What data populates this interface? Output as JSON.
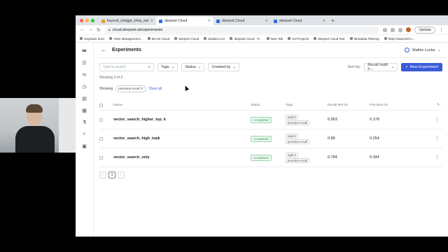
{
  "browser": {
    "tabs": [
      {
        "label": "beyond_chatgpt_infoq_webin...",
        "active": false
      },
      {
        "label": "deepset Cloud",
        "active": true
      },
      {
        "label": "deepset Cloud",
        "active": false
      },
      {
        "label": "deepset Cloud",
        "active": false
      }
    ],
    "url": "cloud.deepset.ai/experiments",
    "update_label": "Update",
    "bookmarks": [
      "Haystack docs",
      "AWS Management...",
      "MAAZ Cloud",
      "deepset Cloud",
      "dualtext ec2",
      "deepset Cloud - P...",
      "New Tab",
      "Sol Projects",
      "deepset Cloud Test",
      "Metadata Filtering",
      "https://www.letf.o..."
    ]
  },
  "header": {
    "title": "Experiments",
    "user_name": "Mathis Lucka"
  },
  "filters": {
    "search_placeholder": "Type to search",
    "tags_label": "Tags",
    "status_label": "Status",
    "created_by_label": "Created by",
    "sort_label": "Sort by:",
    "sort_value": "Recall multi h...",
    "new_button": "New Experiment"
  },
  "showing_text": "Showing 3 of 3",
  "active_filter": {
    "label": "Showing",
    "chip": "precision-recall",
    "clear": "Clear all"
  },
  "table": {
    "columns": {
      "name": "Name",
      "status": "Status",
      "tags": "Tags",
      "recall": "Recall MH int",
      "precision": "Precision int"
    },
    "rows": [
      {
        "name": "vector_search_higher_top_k",
        "status": "Completed",
        "tags": [
          "topk-8",
          "precision-recall"
        ],
        "recall": "0.953",
        "precision": "0.178"
      },
      {
        "name": "vector_search_high_topk",
        "status": "Completed",
        "tags": [
          "topk-5",
          "precision-recall"
        ],
        "recall": "0.89",
        "precision": "0.254"
      },
      {
        "name": "vector_search_only",
        "status": "Completed",
        "tags": [
          "topk-3",
          "precision-recall"
        ],
        "recall": "0.784",
        "precision": "0.344"
      }
    ]
  },
  "pagination": {
    "current": "1"
  },
  "colors": {
    "accent": "#3a5bd9",
    "success": "#2e9b57"
  }
}
